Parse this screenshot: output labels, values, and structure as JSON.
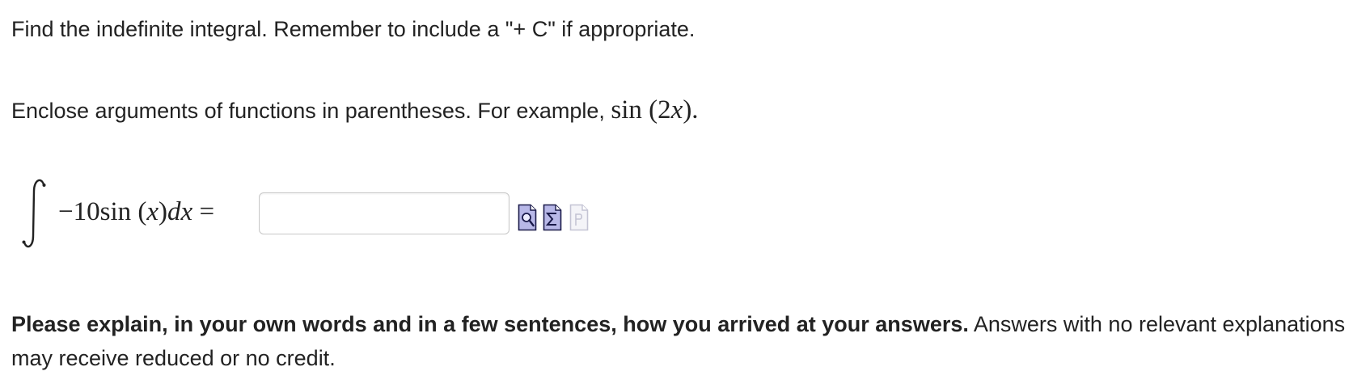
{
  "instructions": {
    "line1": "Find the indefinite integral. Remember to include a \"+ C\" if appropriate.",
    "line2_text": "Enclose arguments of functions in parentheses. For example, ",
    "line2_example": "sin (2",
    "line2_example_var": "x",
    "line2_example_end": ").",
    "explain_bold": "Please explain, in your own words and in a few sentences, how you arrived at your answers.",
    "explain_rest": " Answers with no relevant explanations may receive reduced or no credit."
  },
  "problem": {
    "coefficient": "−10sin (",
    "variable": "x",
    "close": ")",
    "differential": "dx",
    "equals": " ="
  },
  "answer": {
    "value": "",
    "placeholder": ""
  },
  "tools": {
    "preview_icon": "preview-magnifier-icon",
    "equation_icon": "equation-editor-sigma-icon",
    "disabled_icon": "disabled-document-icon"
  },
  "colors": {
    "text": "#222222",
    "input_border": "#c8c8c8",
    "icon_fill": "#b8b8e8",
    "icon_stroke": "#1a1a4a",
    "icon_disabled": "#c4c4d4"
  }
}
